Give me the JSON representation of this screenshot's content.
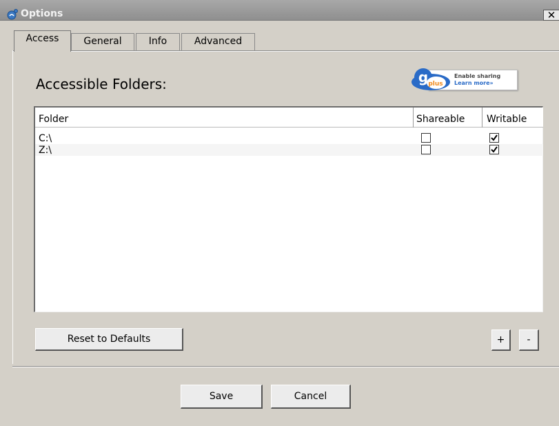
{
  "window": {
    "title": "Options",
    "close_glyph": "✕"
  },
  "tabs": [
    {
      "label": "Access",
      "active": true
    },
    {
      "label": "General",
      "active": false
    },
    {
      "label": "Info",
      "active": false
    },
    {
      "label": "Advanced",
      "active": false
    }
  ],
  "access": {
    "section_title": "Accessible Folders:",
    "gplus": {
      "logo_text": "g",
      "logo_sub": "plus",
      "line1": "Enable sharing",
      "line2": "Learn more»"
    },
    "table": {
      "columns": [
        "Folder",
        "Shareable",
        "Writable"
      ],
      "rows": [
        {
          "folder": "C:\\",
          "shareable": false,
          "writable": true
        },
        {
          "folder": "Z:\\",
          "shareable": false,
          "writable": true
        }
      ]
    },
    "reset_label": "Reset to Defaults",
    "add_label": "+",
    "remove_label": "-"
  },
  "footer": {
    "save_label": "Save",
    "cancel_label": "Cancel"
  },
  "colors": {
    "window_bg": "#d4d0c8",
    "titlebar": "#9c9c9c",
    "gplus_blue": "#2a6bc7",
    "gplus_orange": "#f08a1c"
  },
  "icons": {
    "app": "app-icon",
    "close": "close-icon",
    "gplus": "gplus-logo-icon",
    "check": "check-icon"
  }
}
